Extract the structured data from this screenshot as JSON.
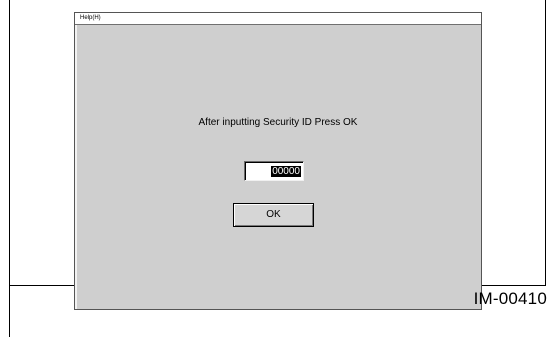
{
  "menu": {
    "help_label": "Help(H)"
  },
  "dialog": {
    "prompt": "After inputting Security ID Press OK",
    "security_id_value": "00000",
    "ok_label": "OK"
  },
  "figure_label": "IM-00410"
}
